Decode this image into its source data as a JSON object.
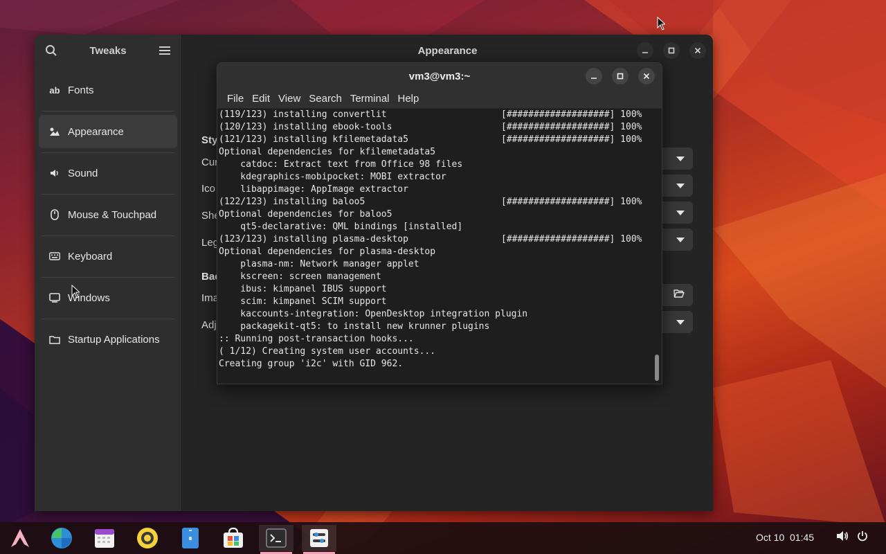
{
  "tweaks": {
    "title": "Tweaks",
    "page_title": "Appearance",
    "nav": [
      {
        "label": "Fonts",
        "icon": "fonts-icon",
        "glyph": "ab"
      },
      {
        "label": "Appearance",
        "icon": "appearance-icon",
        "glyph": ""
      },
      {
        "label": "Sound",
        "icon": "speaker-icon",
        "glyph": "🔈"
      },
      {
        "label": "Mouse & Touchpad",
        "icon": "mouse-icon",
        "glyph": ""
      },
      {
        "label": "Keyboard",
        "icon": "keyboard-icon",
        "glyph": ""
      },
      {
        "label": "Windows",
        "icon": "window-icon",
        "glyph": ""
      },
      {
        "label": "Startup Applications",
        "icon": "folder-icon",
        "glyph": ""
      }
    ],
    "styles_heading": "Sty",
    "cursor_label": "Cur",
    "icons_label": "Ico",
    "shell_label": "She",
    "legacy_label": "Leg",
    "background_heading": "Bac",
    "image_label": "Ima",
    "adjust_label": "Adj"
  },
  "terminal": {
    "title": "vm3@vm3:~",
    "menu": [
      "File",
      "Edit",
      "View",
      "Search",
      "Terminal",
      "Help"
    ],
    "lines": [
      {
        "text": "(119/123) installing convertlit",
        "bar": "[###################] 100%"
      },
      {
        "text": "(120/123) installing ebook-tools",
        "bar": "[###################] 100%"
      },
      {
        "text": "(121/123) installing kfilemetadata5",
        "bar": "[###################] 100%"
      },
      {
        "text": "Optional dependencies for kfilemetadata5",
        "bar": ""
      },
      {
        "text": "    catdoc: Extract text from Office 98 files",
        "bar": ""
      },
      {
        "text": "    kdegraphics-mobipocket: MOBI extractor",
        "bar": ""
      },
      {
        "text": "    libappimage: AppImage extractor",
        "bar": ""
      },
      {
        "text": "(122/123) installing baloo5",
        "bar": "[###################] 100%"
      },
      {
        "text": "Optional dependencies for baloo5",
        "bar": ""
      },
      {
        "text": "    qt5-declarative: QML bindings [installed]",
        "bar": ""
      },
      {
        "text": "(123/123) installing plasma-desktop",
        "bar": "[###################] 100%"
      },
      {
        "text": "Optional dependencies for plasma-desktop",
        "bar": ""
      },
      {
        "text": "    plasma-nm: Network manager applet",
        "bar": ""
      },
      {
        "text": "    kscreen: screen management",
        "bar": ""
      },
      {
        "text": "    ibus: kimpanel IBUS support",
        "bar": ""
      },
      {
        "text": "    scim: kimpanel SCIM support",
        "bar": ""
      },
      {
        "text": "    kaccounts-integration: OpenDesktop integration plugin",
        "bar": ""
      },
      {
        "text": "    packagekit-qt5: to install new krunner plugins",
        "bar": ""
      },
      {
        "text": ":: Running post-transaction hooks...",
        "bar": ""
      },
      {
        "text": "( 1/12) Creating system user accounts...",
        "bar": ""
      },
      {
        "text": "Creating group 'i2c' with GID 962.",
        "bar": ""
      }
    ]
  },
  "taskbar": {
    "clock": "Oct 10  01:45",
    "apps": [
      "arch-launcher-icon",
      "browser-icon",
      "calendar-icon",
      "music-icon",
      "files-icon",
      "software-store-icon",
      "terminal-icon",
      "tweaks-icon"
    ]
  },
  "colors": {
    "accent": "#f5a0b6",
    "window_bg": "#242424",
    "sidebar_bg": "#2e2e2e",
    "terminal_bg": "#1e1e1e"
  }
}
